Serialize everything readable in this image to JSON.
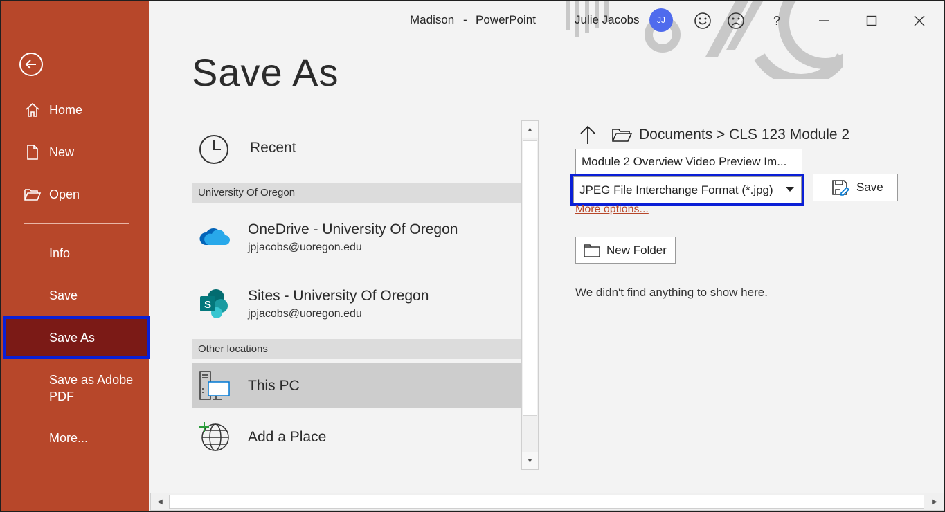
{
  "window": {
    "document_name": "Madison",
    "separator": "-",
    "app_name": "PowerPoint",
    "user_name": "Julie Jacobs",
    "user_initials": "JJ",
    "help_label": "?"
  },
  "sidebar": {
    "items": [
      {
        "label": "Home",
        "icon": "home-icon"
      },
      {
        "label": "New",
        "icon": "new-document-icon"
      },
      {
        "label": "Open",
        "icon": "open-folder-icon"
      },
      {
        "label": "Info"
      },
      {
        "label": "Save"
      },
      {
        "label": "Save As",
        "selected": true
      },
      {
        "label": "Save as Adobe PDF"
      },
      {
        "label": "More..."
      }
    ]
  },
  "page": {
    "title": "Save As"
  },
  "locations": {
    "recent": {
      "label": "Recent"
    },
    "section_university": "University Of Oregon",
    "onedrive": {
      "name": "OneDrive - University Of Oregon",
      "account": "jpjacobs@uoregon.edu"
    },
    "sites": {
      "name": "Sites - University Of Oregon",
      "account": "jpjacobs@uoregon.edu"
    },
    "section_other": "Other locations",
    "this_pc": {
      "label": "This PC"
    },
    "add_place": {
      "label": "Add a Place"
    }
  },
  "save_pane": {
    "breadcrumb": "Documents > CLS 123 Module 2",
    "file_name": "Module 2 Overview Video Preview Im...",
    "file_type": "JPEG File Interchange Format (*.jpg)",
    "save_label": "Save",
    "more_options": "More options...",
    "new_folder_label": "New Folder",
    "empty_message": "We didn't find anything to show here."
  },
  "colors": {
    "sidebar_bg": "#b7472a",
    "sidebar_selected": "#7b1a16",
    "highlight_outline": "#0a1fd6",
    "avatar": "#4f6bed"
  }
}
